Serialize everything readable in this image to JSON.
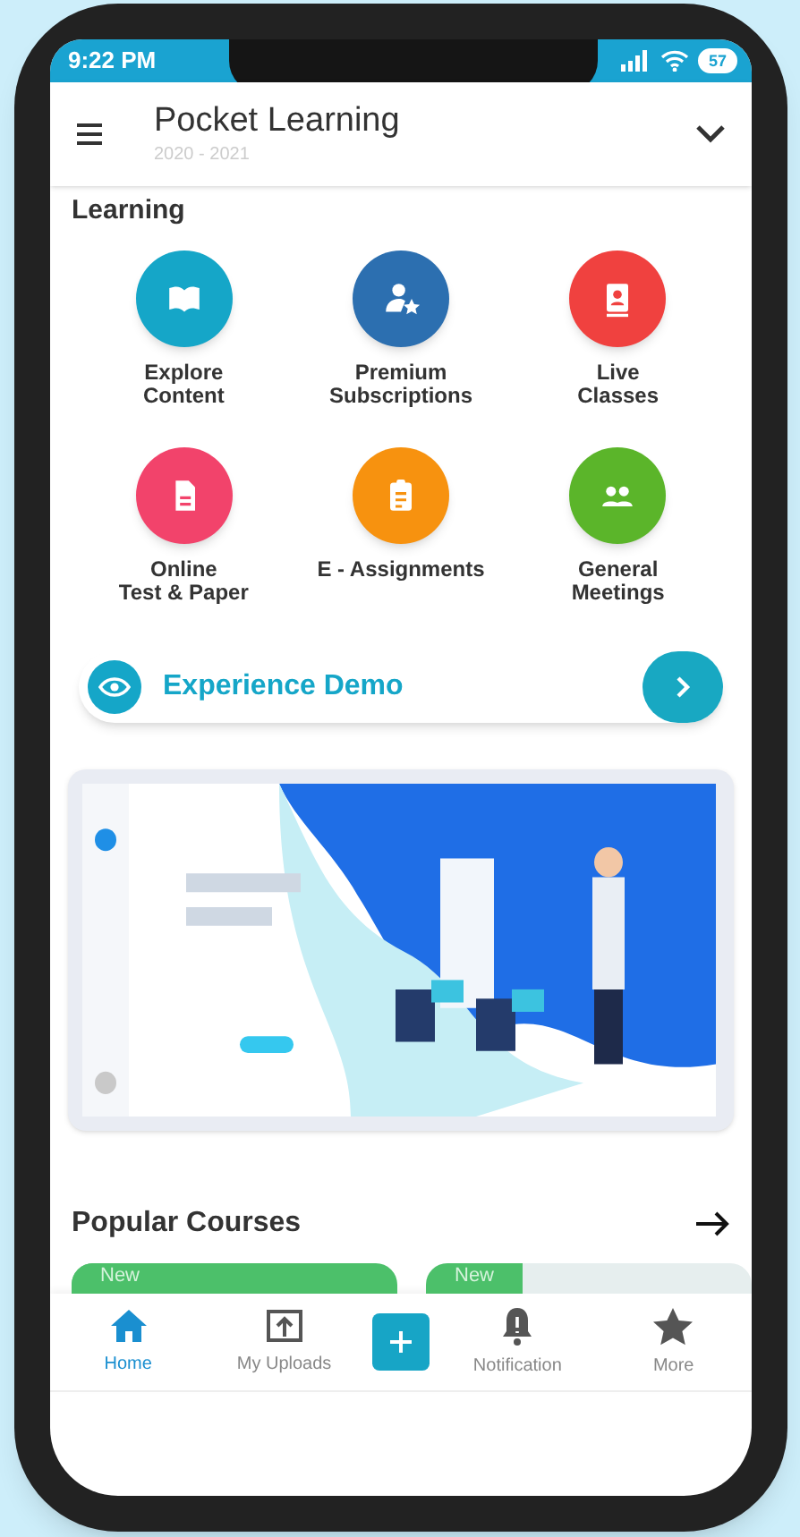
{
  "status_bar": {
    "time": "9:22 PM",
    "battery": "57"
  },
  "header": {
    "title": "Pocket Learning",
    "subtitle": "2020 - 2021"
  },
  "section_title": "Learning",
  "features": [
    {
      "label": "Explore\nContent",
      "color": "#15a6c8"
    },
    {
      "label": "Premium\nSubscriptions",
      "color": "#2c6fb0"
    },
    {
      "label": "Live\nClasses",
      "color": "#f0413f"
    },
    {
      "label": "Online\nTest & Paper",
      "color": "#f2436b"
    },
    {
      "label": "E - Assignments",
      "color": "#f7920f"
    },
    {
      "label": "General\nMeetings",
      "color": "#5bb52a"
    }
  ],
  "demo": {
    "label": "Experience Demo"
  },
  "popular": {
    "title": "Popular Courses",
    "cards": [
      {
        "badge": "New"
      },
      {
        "badge": "New"
      }
    ]
  },
  "nav": [
    {
      "kind": "tab",
      "label": "Home",
      "selected": true
    },
    {
      "kind": "tab",
      "label": "My Uploads",
      "selected": false
    },
    {
      "kind": "add"
    },
    {
      "kind": "tab",
      "label": "Notification",
      "selected": false
    },
    {
      "kind": "tab",
      "label": "More",
      "selected": false
    }
  ]
}
